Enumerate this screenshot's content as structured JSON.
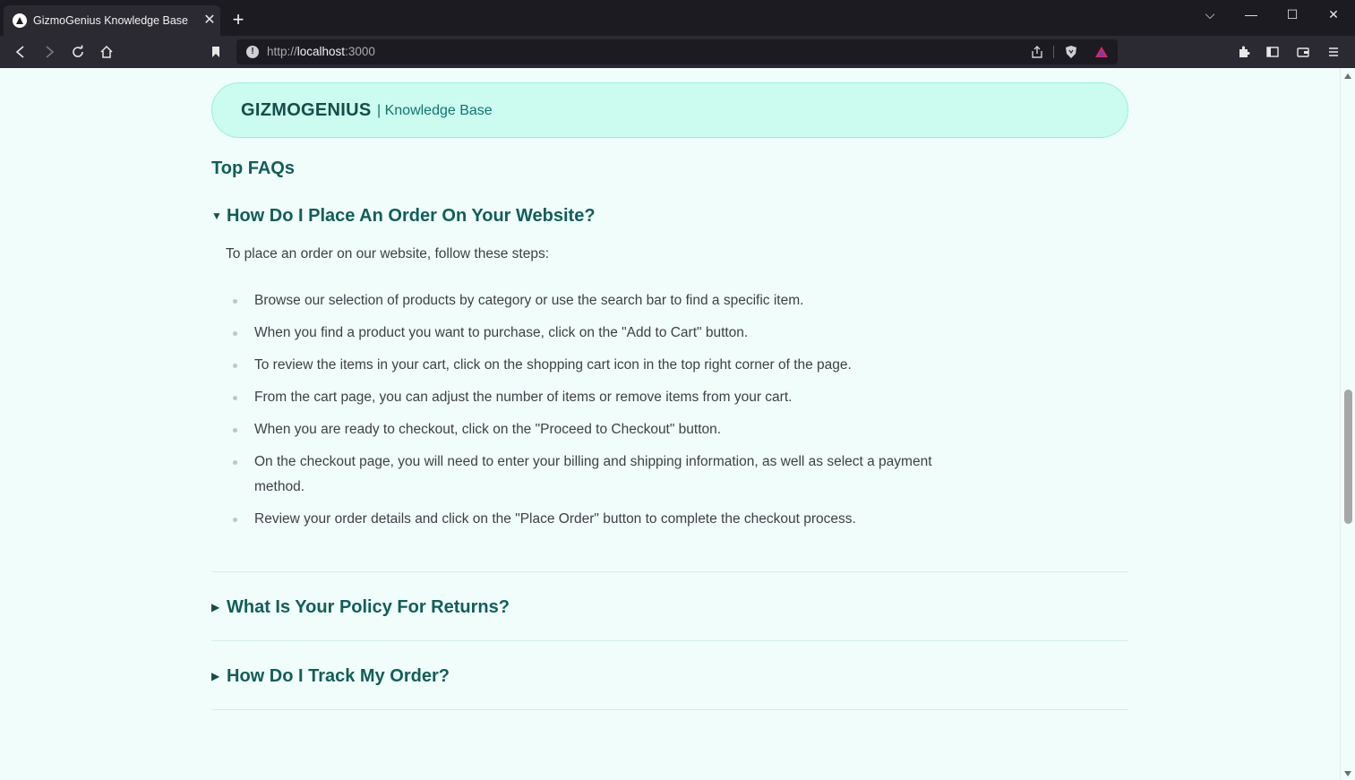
{
  "browser": {
    "tab_title": "GizmoGenius Knowledge Base",
    "tab_close": "✕",
    "new_tab": "+",
    "url_scheme": "http://",
    "url_host": "localhost",
    "url_port": ":3000",
    "window_controls": {
      "list_tabs": "⌵",
      "minimize": "—",
      "maximize": "☐",
      "close": "✕"
    }
  },
  "header": {
    "brand": "GIZMOGENIUS",
    "subtitle": "| Knowledge Base"
  },
  "section_title": "Top FAQs",
  "faqs": [
    {
      "caret": "▼",
      "question": "How Do I Place An Order On Your Website?",
      "expanded": true,
      "intro": "To place an order on our website, follow these steps:",
      "steps": [
        "Browse our selection of products by category or use the search bar to find a specific item.",
        "When you find a product you want to purchase, click on the \"Add to Cart\" button.",
        "To review the items in your cart, click on the shopping cart icon in the top right corner of the page.",
        "From the cart page, you can adjust the number of items or remove items from your cart.",
        "When you are ready to checkout, click on the \"Proceed to Checkout\" button.",
        "On the checkout page, you will need to enter your billing and shipping information, as well as select a payment method.",
        "Review your order details and click on the \"Place Order\" button to complete the checkout process."
      ]
    },
    {
      "caret": "▶",
      "question": "What Is Your Policy For Returns?",
      "expanded": false
    },
    {
      "caret": "▶",
      "question": "How Do I Track My Order?",
      "expanded": false
    }
  ],
  "colors": {
    "page_bg": "#f0fdfa",
    "header_bg": "#ccfbef",
    "accent": "#115e59",
    "body_text": "#3f3f46"
  }
}
